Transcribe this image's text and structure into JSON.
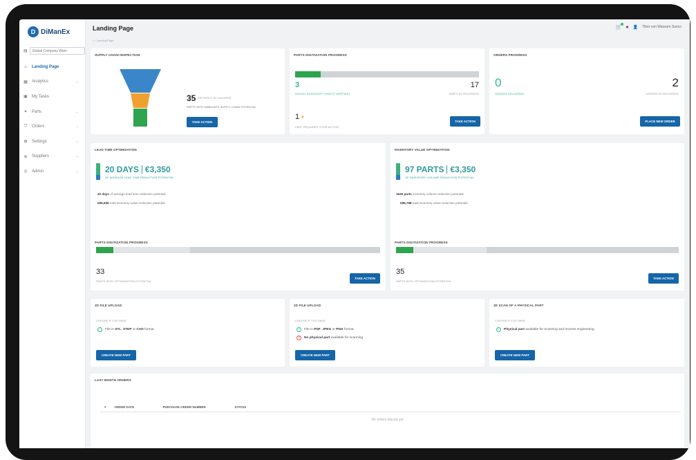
{
  "app": {
    "logo_letter": "D",
    "logo_text": "DiManEx"
  },
  "sidebar": {
    "company_select": "Global Company Warn",
    "items": [
      {
        "label": "Landing Page",
        "icon": "home-icon",
        "glyph": "⌂",
        "active": true,
        "chevron": false
      },
      {
        "label": "Analytics",
        "icon": "chart-icon",
        "glyph": "▦",
        "active": false,
        "chevron": true
      },
      {
        "label": "My Tasks",
        "icon": "tasks-icon",
        "glyph": "▣",
        "active": false,
        "chevron": false
      },
      {
        "label": "Parts",
        "icon": "parts-icon",
        "glyph": "✦",
        "active": false,
        "chevron": true
      },
      {
        "label": "Orders",
        "icon": "cart-icon",
        "glyph": "⛉",
        "active": false,
        "chevron": true
      },
      {
        "label": "Settings",
        "icon": "gear-icon",
        "glyph": "✿",
        "active": false,
        "chevron": true
      },
      {
        "label": "Suppliers",
        "icon": "suppliers-icon",
        "glyph": "⊕",
        "active": false,
        "chevron": true
      },
      {
        "label": "Admin",
        "icon": "admin-icon",
        "glyph": "◎",
        "active": false,
        "chevron": true
      }
    ]
  },
  "header": {
    "title": "Landing Page",
    "breadcrumb": "⌂ / Landing Page",
    "user": "Tibor van Wassum Sunco"
  },
  "supply_chain": {
    "title": "Supply Chain Inspection",
    "count": "35",
    "count_note": "(35 Parts to be converted)",
    "caption": "Parts with immediate supply chain potential",
    "button": "Take Action"
  },
  "parts_progress": {
    "title": "Parts Digitization Progress",
    "progress": 0.14,
    "left_value": "3",
    "left_caption": "Digital Inventory (Parts Verified)",
    "right_value": "17",
    "right_caption": "Parts in Progress",
    "attention_value": "1",
    "attention_caption": "Part Requires your Action",
    "button": "Take Action"
  },
  "orders_progress": {
    "title": "Orders Progress",
    "left_value": "0",
    "left_caption": "Orders Delivered",
    "right_value": "2",
    "right_caption": "Orders in Progress",
    "button": "Place New Order"
  },
  "lead_time": {
    "title": "Lead Time Optimization",
    "kpi_a": "20 DAYS",
    "kpi_b": "€3,350",
    "kpi_caption": "of average lead time reduction potential",
    "line1_bold": "20 days",
    "line1_rest": " of average lead time reduction potential",
    "line2_bold": "€85,635",
    "line2_rest": " total inventory value reduction potential",
    "progress_title": "Parts Digitization Progress",
    "progress": 0.06,
    "progress_secondary": 0.33,
    "count": "33",
    "count_caption": "Parts with optimization potential",
    "button": "Take Action"
  },
  "inventory_value": {
    "title": "Inventory Value Optimization",
    "kpi_a": "97 PARTS",
    "kpi_b": "€3,350",
    "kpi_caption": "of inventory volume reduction potential",
    "line1_bold": "1640 parts",
    "line1_rest": " inventory volume reduction potential",
    "line2_bold": "€85,798",
    "line2_rest": " total inventory value reduction potential",
    "progress_title": "Parts Digitization Progress",
    "progress": 0.06,
    "progress_secondary": 0.32,
    "count": "35",
    "count_caption": "Parts with optimization potential",
    "button": "Take Action"
  },
  "upload_3d": {
    "title": "3D File Upload",
    "hint": "Choose if you have:",
    "line_pre": "File in ",
    "line_b1": "STL",
    "line_mid1": ", ",
    "line_b2": "STEP",
    "line_mid2": " or ",
    "line_b3": "CAD",
    "line_post": " format",
    "button": "Create New Part"
  },
  "upload_2d": {
    "title": "2D File Upload",
    "hint": "Choose if you have:",
    "line_pre": "File in ",
    "line_b1": "PDF",
    "line_mid1": ", ",
    "line_b2": "JPEG",
    "line_mid2": " or ",
    "line_b3": "PNG",
    "line_post": " format",
    "line2_bold": "No physical part",
    "line2_rest": " available for scanning",
    "button": "Create New Part"
  },
  "scan_3d": {
    "title": "3D Scan of a Physical Part",
    "hint": "Choose if you have:",
    "line_bold": "Physical part",
    "line_rest": " available for scanning and reverse engineering",
    "button": "Create New Part"
  },
  "last_orders": {
    "title": "Last Month Orders",
    "columns": [
      "#",
      "Order Date",
      "Purchase Order Number",
      "Status"
    ],
    "empty": "No orders placed yet"
  },
  "colors": {
    "brand": "#1565a8",
    "green": "#2ea44f",
    "teal": "#2e9b9b",
    "funnel_top": "#3a86c8",
    "funnel_mid": "#f0a030",
    "funnel_bot": "#2ea44f"
  }
}
